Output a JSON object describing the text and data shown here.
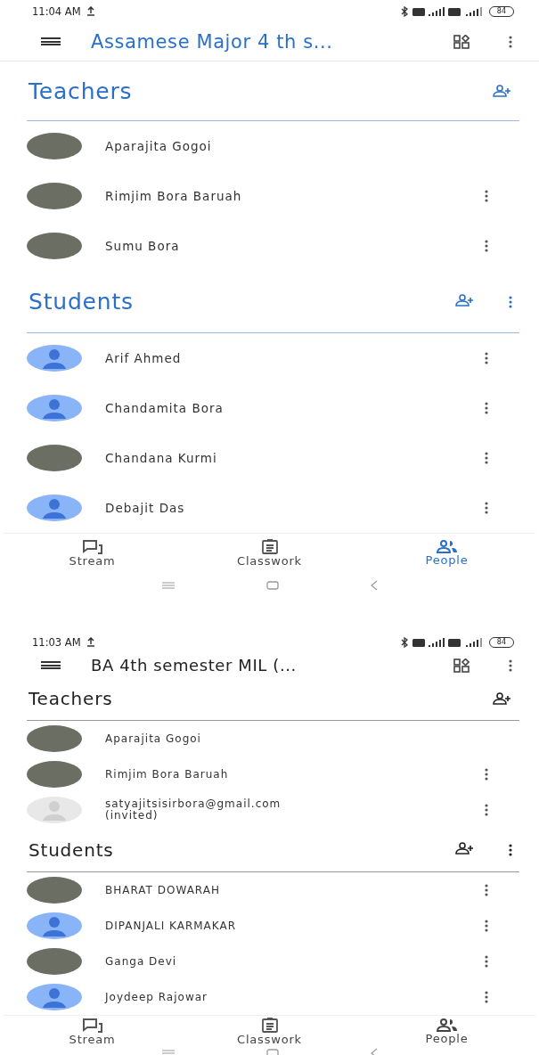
{
  "screens": [
    {
      "kind": "color",
      "status_bar": {
        "time": "11:04 AM",
        "battery": "84"
      },
      "app_bar": {
        "title": "Assamese Major 4 th s..."
      },
      "teachers": {
        "heading": "Teachers",
        "people": [
          {
            "name": "Aparajita Gogoi",
            "kind": "photo",
            "menu": false
          },
          {
            "name": "Rimjim Bora Baruah",
            "kind": "photo",
            "menu": true
          },
          {
            "name": "Sumu Bora",
            "kind": "photo",
            "menu": true
          }
        ]
      },
      "students": {
        "heading": "Students",
        "people": [
          {
            "name": "Arif Ahmed",
            "kind": "default",
            "menu": true
          },
          {
            "name": "Chandamita Bora",
            "kind": "default",
            "menu": true
          },
          {
            "name": "Chandana Kurmi",
            "kind": "photo",
            "menu": true
          },
          {
            "name": "Debajit Das",
            "kind": "default",
            "menu": true
          }
        ]
      },
      "tabs": [
        {
          "label": "Stream",
          "selected": false
        },
        {
          "label": "Classwork",
          "selected": false
        },
        {
          "label": "People",
          "selected": true
        }
      ]
    },
    {
      "kind": "monochrome",
      "status_bar": {
        "time": "11:03 AM",
        "battery": "84"
      },
      "app_bar": {
        "title": "BA 4th semester  MIL (..."
      },
      "teachers": {
        "heading": "Teachers",
        "people": [
          {
            "name": "Aparajita Gogoi",
            "kind": "photo",
            "menu": false
          },
          {
            "name": "Rimjim Bora Baruah",
            "kind": "photo",
            "menu": true
          },
          {
            "name": "satyajitsisirbora@gmail.com",
            "note": "(invited)",
            "kind": "invited",
            "menu": true
          }
        ]
      },
      "students": {
        "heading": "Students",
        "people": [
          {
            "name": "BHARAT DOWARAH",
            "kind": "photo",
            "menu": true
          },
          {
            "name": "DIPANJALI KARMAKAR",
            "kind": "default",
            "menu": true
          },
          {
            "name": "Ganga Devi",
            "kind": "photo",
            "menu": true
          },
          {
            "name": "Joydeep Rajowar",
            "kind": "default",
            "menu": true
          }
        ]
      },
      "tabs": [
        {
          "label": "Stream",
          "selected": false
        },
        {
          "label": "Classwork",
          "selected": false
        },
        {
          "label": "People",
          "selected": false
        }
      ]
    }
  ]
}
